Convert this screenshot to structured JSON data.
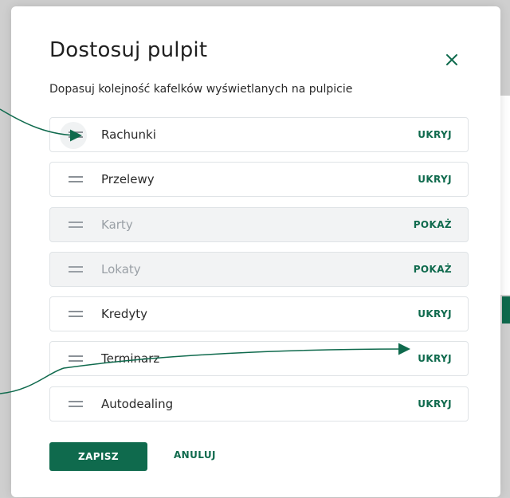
{
  "dialog": {
    "title": "Dostosuj pulpit",
    "subtitle": "Dopasuj kolejność kafelków wyświetlanych na pulpicie",
    "close_icon": "close-icon"
  },
  "tiles": [
    {
      "label": "Rachunki",
      "action": "UKRYJ",
      "visible": true
    },
    {
      "label": "Przelewy",
      "action": "UKRYJ",
      "visible": true
    },
    {
      "label": "Karty",
      "action": "POKAŻ",
      "visible": false
    },
    {
      "label": "Lokaty",
      "action": "POKAŻ",
      "visible": false
    },
    {
      "label": "Kredyty",
      "action": "UKRYJ",
      "visible": true
    },
    {
      "label": "Terminarz",
      "action": "UKRYJ",
      "visible": true
    },
    {
      "label": "Autodealing",
      "action": "UKRYJ",
      "visible": true
    }
  ],
  "buttons": {
    "save_label": "ZAPISZ",
    "cancel_label": "ANULUJ"
  },
  "colors": {
    "accent": "#0f6a4d",
    "hidden_tile_bg": "#f2f3f4",
    "hidden_text": "#9aa0a6"
  }
}
